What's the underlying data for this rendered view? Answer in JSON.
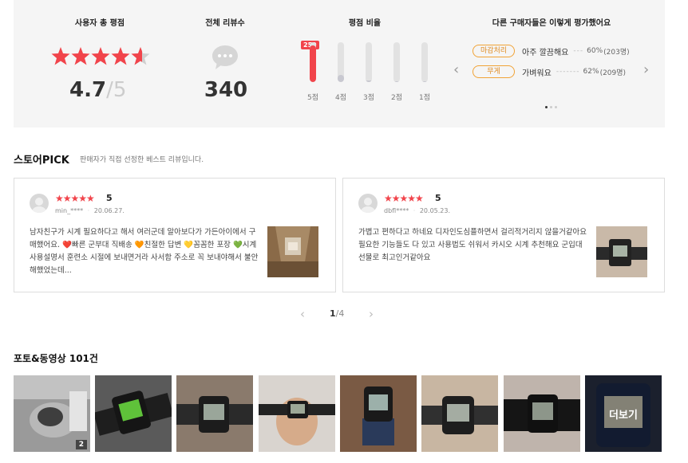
{
  "summary": {
    "rating_title": "사용자 총 평점",
    "average": "4.7",
    "average_max": "5",
    "reviews_title": "전체 리뷰수",
    "total_reviews": "340",
    "ratio_title": "평점 비율",
    "top_badge": "259",
    "ratio": [
      {
        "label": "5점",
        "fraction": 0.93,
        "color": "#f1444b"
      },
      {
        "label": "4점",
        "fraction": 0.18,
        "color": "#c8c8d0"
      },
      {
        "label": "3점",
        "fraction": 0.05,
        "color": "#c8c8d0"
      },
      {
        "label": "2점",
        "fraction": 0.02,
        "color": "#c8c8d0"
      },
      {
        "label": "1점",
        "fraction": 0.02,
        "color": "#c8c8d0"
      }
    ],
    "eval_title": "다른 구매자들은 이렇게 평가했어요",
    "evaluations": [
      {
        "tag": "마감처리",
        "desc": "아주 깔끔해요",
        "dash": "---",
        "pct": "60%",
        "count": "(203명)"
      },
      {
        "tag": "무게",
        "desc": "가벼워요",
        "dash": "-------",
        "pct": "62%",
        "count": "(209명)"
      }
    ],
    "accent_color": "#f1444b"
  },
  "store_pick": {
    "title": "스토어PICK",
    "subtitle": "판매자가 직접 선정한 베스트 리뷰입니다.",
    "reviews": [
      {
        "stars": "★★★★★",
        "score": "5",
        "user": "min_****",
        "date": "20.06.27.",
        "text": "남자친구가 시계 필요하다고 해서 여러군데 알아보다가 가든아이에서 구매했어요. ❤️빠른 군부대 직배송 🧡친절한 답변 💛꼼꼼한 포장 💚시계 사용설명서 훈련소 시절에 보내면거라 사서함 주소로 꼭 보내야해서 불안해했었는데..."
      },
      {
        "stars": "★★★★★",
        "score": "5",
        "user": "dbfl****",
        "date": "20.05.23.",
        "text": "가볍고 편하다고 하네요 디자인도심플하면서 걸리적거리지 않을거같아요 필요한 기능들도 다 있고 사용법도 쉬워서 카시오 시계 추천해요 군입대 선물로 최고인거같아요"
      }
    ],
    "page_current": "1",
    "page_total": "4"
  },
  "photos": {
    "title": "포토&동영상",
    "count": "101건",
    "first_badge": "2",
    "more_label": "더보기",
    "items": [
      "photo-1",
      "photo-2",
      "photo-3",
      "photo-4",
      "photo-5",
      "photo-6",
      "photo-7",
      "photo-8"
    ]
  }
}
